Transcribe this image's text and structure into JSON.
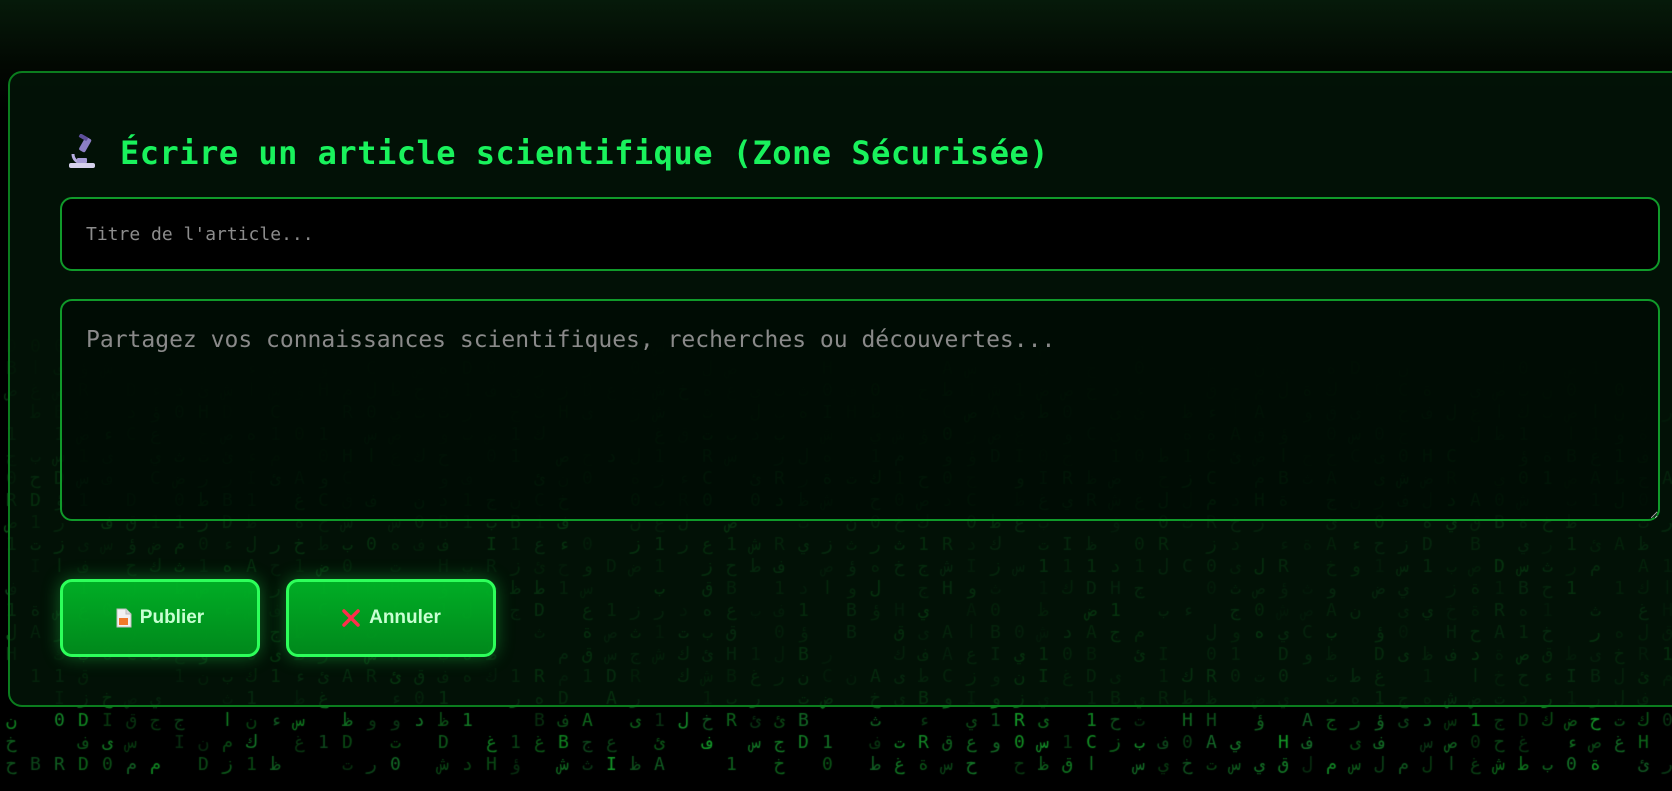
{
  "form": {
    "title": "Écrire un article scientifique (Zone Sécurisée)",
    "title_placeholder": "Titre de l'article...",
    "title_value": "",
    "content_placeholder": "Partagez vos connaissances scientifiques, recherches ou découvertes...",
    "content_value": ""
  },
  "actions": {
    "publish_label": "Publier",
    "cancel_label": "Annuler"
  },
  "icons": {
    "title": "microscope-icon",
    "publish": "document-icon",
    "cancel": "cross-icon"
  },
  "colors": {
    "accent": "#19f25c",
    "border": "#109a2a",
    "button": "#00b82a",
    "cancel_icon": "#ff2d4b",
    "background": "#000000"
  }
}
